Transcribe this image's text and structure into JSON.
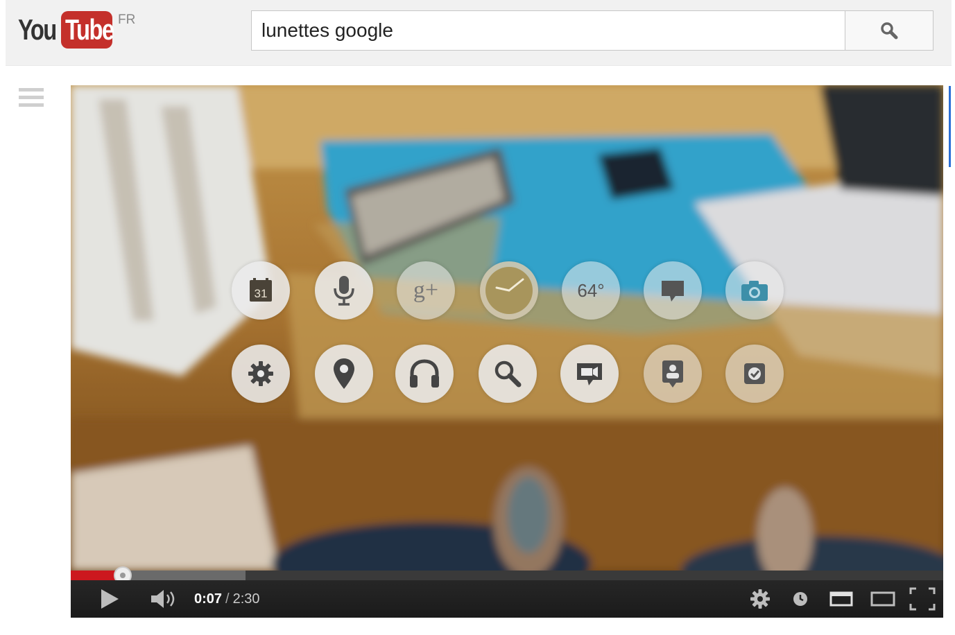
{
  "masthead": {
    "logo_you": "You",
    "logo_tube": "Tube",
    "country": "FR",
    "search_value": "lunettes google"
  },
  "glass_menu": {
    "row1": [
      {
        "icon": "calendar-icon",
        "label": "31"
      },
      {
        "icon": "microphone-icon",
        "label": ""
      },
      {
        "icon": "google-plus-icon",
        "label": "g+"
      },
      {
        "icon": "clock-icon",
        "label": ""
      },
      {
        "icon": "weather-icon",
        "label": "64°"
      },
      {
        "icon": "chat-icon",
        "label": ""
      },
      {
        "icon": "camera-icon",
        "label": ""
      }
    ],
    "row2": [
      {
        "icon": "gear-icon",
        "label": ""
      },
      {
        "icon": "map-pin-icon",
        "label": ""
      },
      {
        "icon": "headphones-icon",
        "label": ""
      },
      {
        "icon": "search-icon",
        "label": ""
      },
      {
        "icon": "video-chat-icon",
        "label": ""
      },
      {
        "icon": "contact-icon",
        "label": ""
      },
      {
        "icon": "checkbox-icon",
        "label": ""
      }
    ]
  },
  "player": {
    "current_time": "0:07",
    "separator": "/",
    "duration": "2:30",
    "played_fraction": 0.06,
    "buffered_fraction": 0.2,
    "accent_color": "#cc181e"
  }
}
